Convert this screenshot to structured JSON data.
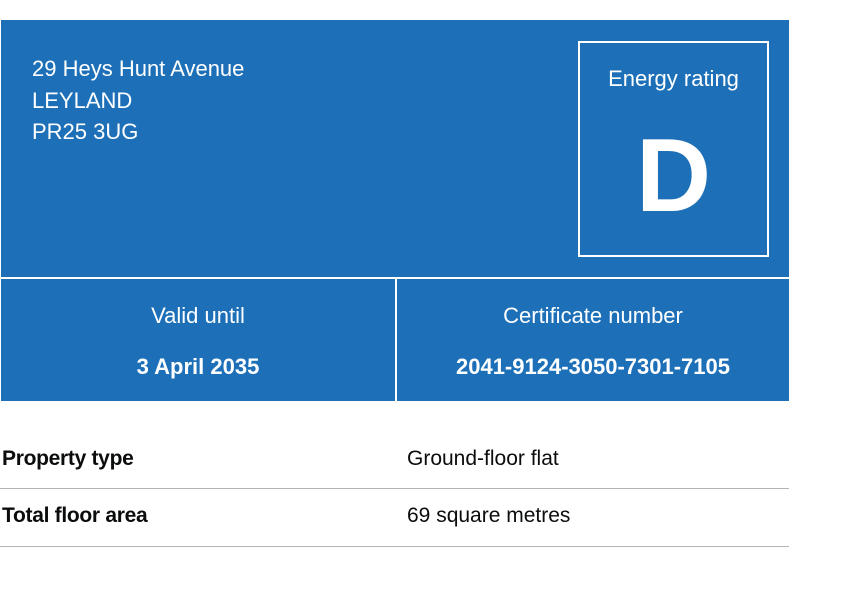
{
  "address": {
    "line1": "29 Heys Hunt Avenue",
    "line2": "LEYLAND",
    "postcode": "PR25 3UG"
  },
  "energy_rating": {
    "label": "Energy rating",
    "value": "D"
  },
  "valid_until": {
    "label": "Valid until",
    "value": "3 April 2035"
  },
  "certificate": {
    "label": "Certificate number",
    "value": "2041-9124-3050-7301-7105"
  },
  "summary": [
    {
      "key": "Property type",
      "value": "Ground-floor flat"
    },
    {
      "key": "Total floor area",
      "value": "69 square metres"
    }
  ],
  "colors": {
    "brand_blue": "#1d70b8",
    "divider": "#b1b4b6"
  }
}
